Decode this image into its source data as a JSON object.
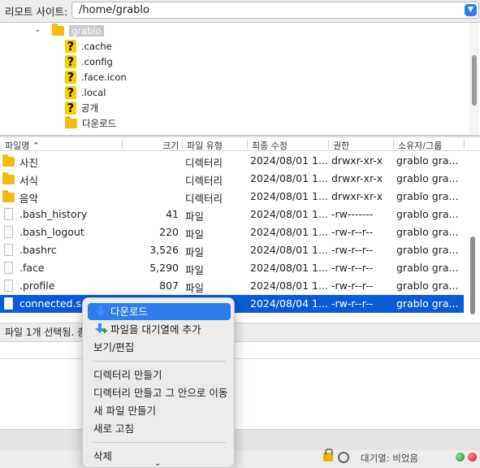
{
  "site_bar": {
    "label": "리모트 사이트:",
    "path": "/home/grablo"
  },
  "tree": {
    "root": "grablo",
    "items": [
      ".cache",
      ".config",
      ".face.icon",
      ".local",
      "공개",
      "다운로드"
    ]
  },
  "columns": [
    "파일명",
    "크기",
    "파일 유형",
    "최종 수정",
    "권한",
    "소유자/그룹"
  ],
  "files": [
    {
      "name": "사진",
      "size": "",
      "type": "디렉터리",
      "modified": "2024/08/01 1...",
      "perm": "drwxr-xr-x",
      "owner": "grablo gra...",
      "kind": "folder"
    },
    {
      "name": "서식",
      "size": "",
      "type": "디렉터리",
      "modified": "2024/08/01 1...",
      "perm": "drwxr-xr-x",
      "owner": "grablo gra...",
      "kind": "folder"
    },
    {
      "name": "음악",
      "size": "",
      "type": "디렉터리",
      "modified": "2024/08/01 1...",
      "perm": "drwxr-xr-x",
      "owner": "grablo gra...",
      "kind": "folder"
    },
    {
      "name": ".bash_history",
      "size": "41",
      "type": "파일",
      "modified": "2024/08/01 1...",
      "perm": "-rw-------",
      "owner": "grablo gra...",
      "kind": "file"
    },
    {
      "name": ".bash_logout",
      "size": "220",
      "type": "파일",
      "modified": "2024/08/01 1...",
      "perm": "-rw-r--r--",
      "owner": "grablo gra...",
      "kind": "file"
    },
    {
      "name": ".bashrc",
      "size": "3,526",
      "type": "파일",
      "modified": "2024/08/01 1...",
      "perm": "-rw-r--r--",
      "owner": "grablo gra...",
      "kind": "file"
    },
    {
      "name": ".face",
      "size": "5,290",
      "type": "파일",
      "modified": "2024/08/01 1...",
      "perm": "-rw-r--r--",
      "owner": "grablo gra...",
      "kind": "file"
    },
    {
      "name": ".profile",
      "size": "807",
      "type": "파일",
      "modified": "2024/08/01 1...",
      "perm": "-rw-r--r--",
      "owner": "grablo gra...",
      "kind": "file"
    },
    {
      "name": "connected.s",
      "size": "",
      "type": "",
      "modified": "2024/08/04 1...",
      "perm": "-rw-r--r--",
      "owner": "grablo gra...",
      "kind": "file",
      "selected": true
    }
  ],
  "status": "파일 1개 선택됨. 총",
  "context_menu": {
    "download": "다운로드",
    "add_queue": "파일을 대기열에 추가",
    "view_edit": "보기/편집",
    "make_dir": "디렉터리 만들기",
    "make_dir_enter": "디렉터리 만들고 그 안으로 이동",
    "new_file": "새 파일 만들기",
    "refresh": "새로 고침",
    "delete": "삭제"
  },
  "bottom": {
    "queue": "대기열: 비었음"
  }
}
